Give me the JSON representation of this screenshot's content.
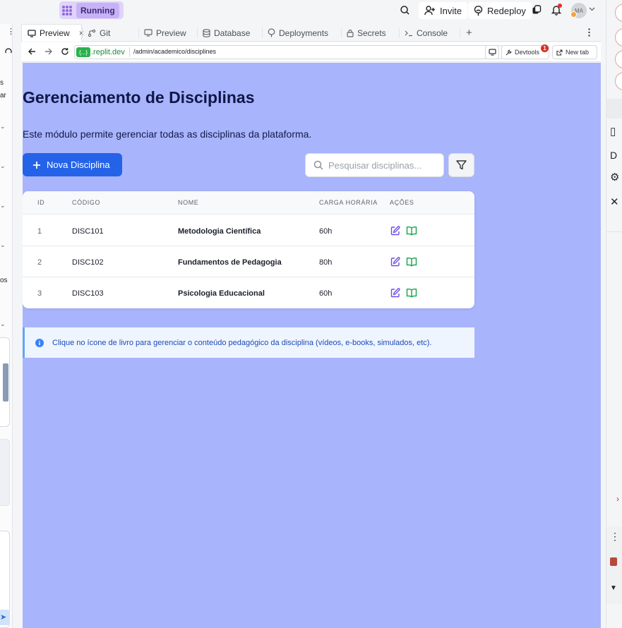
{
  "topbar": {
    "running_label": "Running",
    "invite_label": "Invite",
    "redeploy_label": "Redeploy",
    "avatar_initials": "MA"
  },
  "tabs": [
    {
      "label": "Preview",
      "icon": "monitor-icon",
      "active": true,
      "closable": true
    },
    {
      "label": "Git",
      "icon": "git-branch-icon"
    },
    {
      "label": "Preview",
      "icon": "monitor-icon"
    },
    {
      "label": "Database",
      "icon": "database-icon"
    },
    {
      "label": "Deployments",
      "icon": "balloon-icon"
    },
    {
      "label": "Secrets",
      "icon": "lock-icon"
    },
    {
      "label": "Console",
      "icon": "terminal-icon"
    }
  ],
  "urlbar": {
    "host_icon": "{...}",
    "host": ".replit.dev",
    "path": "/admin/academico/disciplines",
    "devtools_label": "Devtools",
    "devtools_badge": "1",
    "newtab_label": "New tab"
  },
  "page": {
    "title": "Gerenciamento de Disciplinas",
    "description": "Este módulo permite gerenciar todas as disciplinas da plataforma.",
    "new_button": "Nova Disciplina",
    "search_placeholder": "Pesquisar disciplinas...",
    "columns": [
      "ID",
      "CÓDIGO",
      "NOME",
      "CARGA HORÁRIA",
      "AÇÕES"
    ],
    "rows": [
      {
        "id": "1",
        "code": "DISC101",
        "name": "Metodologia Científica",
        "hours": "60h"
      },
      {
        "id": "2",
        "code": "DISC102",
        "name": "Fundamentos de Pedagogia",
        "hours": "80h"
      },
      {
        "id": "3",
        "code": "DISC103",
        "name": "Psicologia Educacional",
        "hours": "60h"
      }
    ],
    "info_text": "Clique no ícone de livro para gerenciar o conteúdo pedagógico da disciplina (vídeos, e-books, simulados, etc)."
  },
  "sidebar_fragments": [
    "s",
    "ar",
    "os"
  ],
  "right_fragments": [
    "D"
  ],
  "colors": {
    "preview_bg": "#a8b4fc",
    "primary": "#2463e8",
    "edit_icon": "#6d4ee0",
    "book_icon": "#16a34a",
    "running_bg": "#c7b2f6"
  }
}
